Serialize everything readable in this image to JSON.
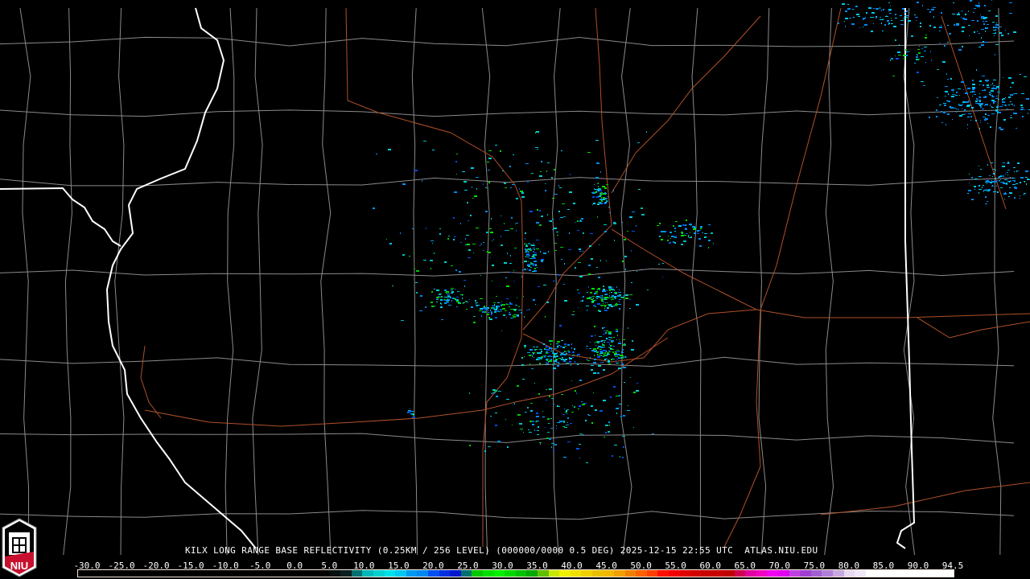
{
  "header": {
    "radar": "KILX",
    "product": "LONG RANGE BASE REFLECTIVITY",
    "resolution": "(0.25KM / 256 LEVEL)",
    "scan": "(000000/0000 0.5 DEG)",
    "timestamp": "2025-12-15 22:55 UTC",
    "site": "ATLAS.NIU.EDU"
  },
  "caption": "KILX LONG RANGE BASE REFLECTIVITY (0.25KM / 256 LEVEL) (000000/0000 0.5 DEG) 2025-12-15 22:55 UTC  ATLAS.NIU.EDU",
  "logo": {
    "text": "NIU"
  },
  "legend": {
    "ticks": [
      "-30.0",
      "-25.0",
      "-20.0",
      "-15.0",
      "-10.0",
      "-5.0",
      "0.0",
      "5.0",
      "10.0",
      "15.0",
      "20.0",
      "25.0",
      "30.0",
      "35.0",
      "40.0",
      "45.0",
      "50.0",
      "55.0",
      "60.0",
      "65.0",
      "70.0",
      "75.0",
      "80.0",
      "85.0",
      "90.0",
      "94.5"
    ],
    "colors": [
      "#000000",
      "#000000",
      "#000000",
      "#000000",
      "#000000",
      "#000000",
      "#000000",
      "#000000",
      "#000000",
      "#000000",
      "#000000",
      "#000000",
      "#000000",
      "#000000",
      "#000000",
      "#000000",
      "#000000",
      "#000000",
      "#000000",
      "#000000",
      "#000000",
      "#000000",
      "#000000",
      "#050f0f",
      "#0a1f1f",
      "#007070",
      "#00b8b8",
      "#00d0d0",
      "#00e0e8",
      "#00c8f0",
      "#0098f0",
      "#0088f0",
      "#0050f0",
      "#0030e0",
      "#0018d0",
      "#007070",
      "#00c800",
      "#00e000",
      "#00f000",
      "#00d800",
      "#00c000",
      "#00a800",
      "#60c000",
      "#c8e800",
      "#f0f000",
      "#f0e000",
      "#f0d000",
      "#e8c000",
      "#f0b800",
      "#f0a000",
      "#f08000",
      "#ff6000",
      "#ff4000",
      "#ff1000",
      "#f00000",
      "#e00000",
      "#d00000",
      "#c80000",
      "#c80000",
      "#c00000",
      "#d00050",
      "#e000a0",
      "#f000c0",
      "#f000f0",
      "#e000f0",
      "#c040e0",
      "#a040d0",
      "#a060d0",
      "#b080d8",
      "#c8a8e0",
      "#e8d8f0",
      "#f0e8f8",
      "#ffffff",
      "#ffffff",
      "#ffffff",
      "#ffffff",
      "#ffffff",
      "#ffffff",
      "#ffffff",
      "#ffffff"
    ]
  },
  "colors": {
    "county": "#8a8a8a",
    "state": "#ffffff",
    "highway": "#b0502a",
    "background": "#000000"
  }
}
